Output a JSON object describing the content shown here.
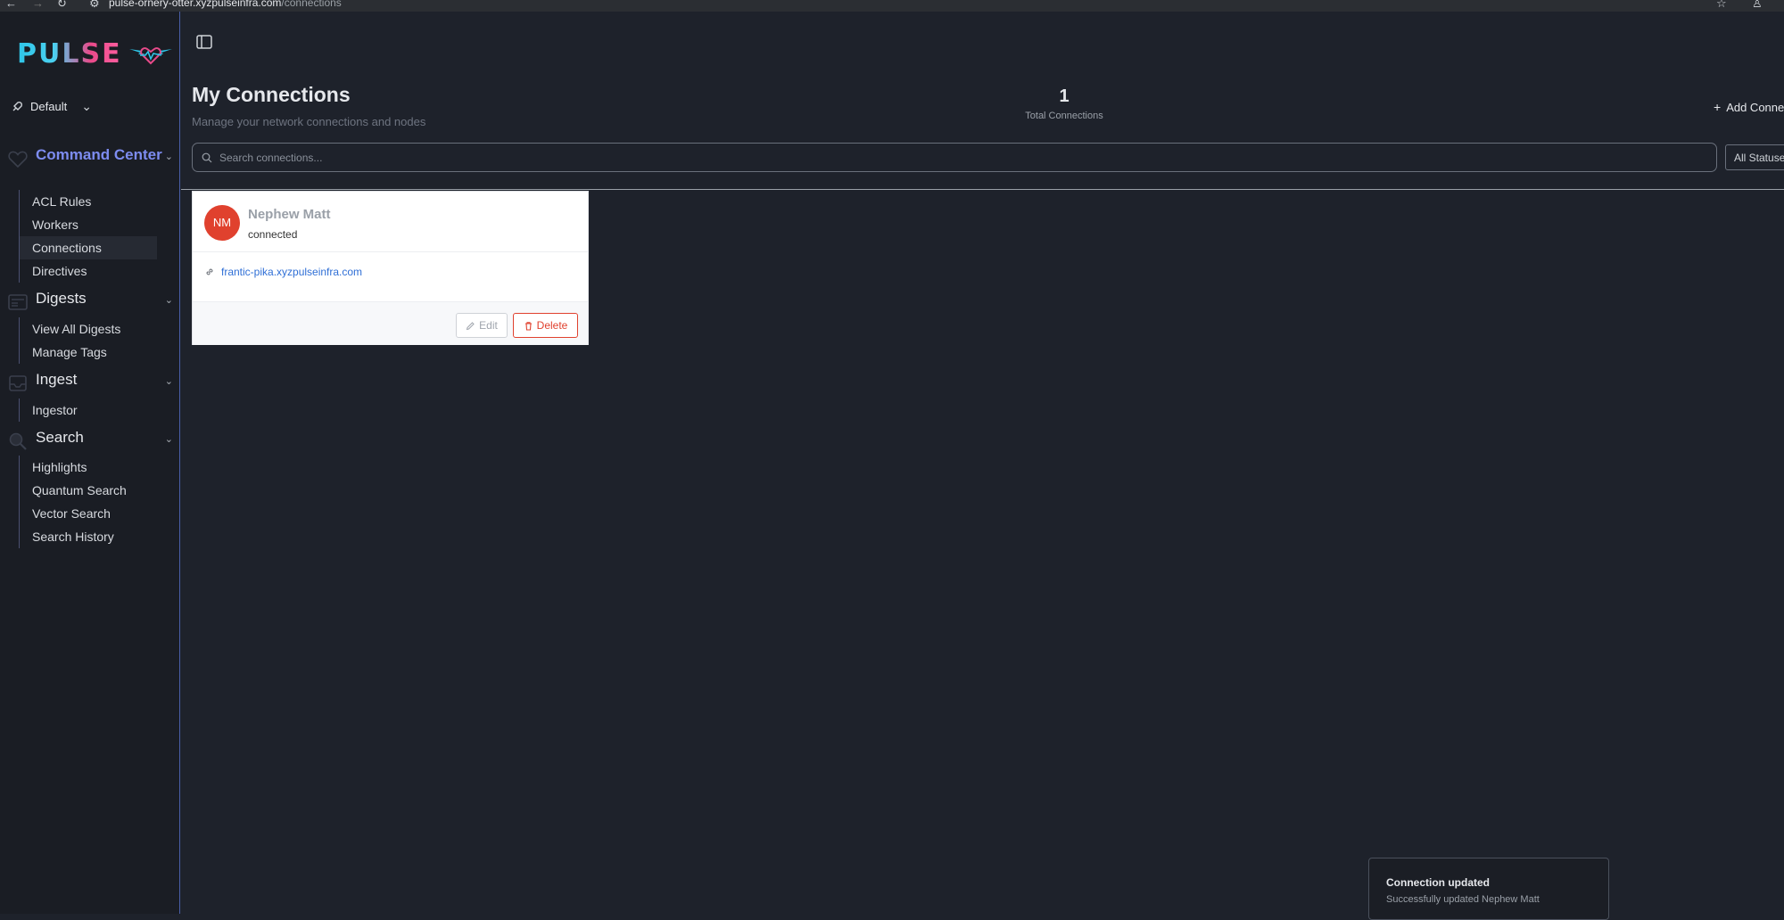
{
  "browser": {
    "url_host": "pulse-ornery-otter.xyzpulseinfra.com",
    "url_path": "/connections"
  },
  "sidebar": {
    "logo_text": "PULSE",
    "workspace": "Default",
    "sections": [
      {
        "label": "Command Center",
        "icon": "heart-outline-icon",
        "items": [
          "ACL Rules",
          "Workers",
          "Connections",
          "Directives"
        ]
      },
      {
        "label": "Digests",
        "icon": "newspaper-icon",
        "items": [
          "View All Digests",
          "Manage Tags"
        ]
      },
      {
        "label": "Ingest",
        "icon": "inbox-icon",
        "items": [
          "Ingestor"
        ]
      },
      {
        "label": "Search",
        "icon": "search-icon",
        "items": [
          "Highlights",
          "Quantum Search",
          "Vector Search",
          "Search History"
        ]
      }
    ],
    "active_item": "Connections"
  },
  "header": {
    "title": "My Connections",
    "subtitle": "Manage your network connections and nodes",
    "total_count": "1",
    "total_label": "Total Connections",
    "add_button": "Add Conne"
  },
  "search": {
    "placeholder": "Search connections...",
    "status_filter": "All Statuse"
  },
  "connections": [
    {
      "initials": "NM",
      "name": "Nephew Matt",
      "status": "connected",
      "host": "frantic-pika.xyzpulseinfra.com",
      "edit_label": "Edit",
      "delete_label": "Delete"
    }
  ],
  "toast": {
    "title": "Connection updated",
    "body": "Successfully updated Nephew Matt"
  },
  "colors": {
    "accent": "#7d8cf0",
    "danger": "#e0412e",
    "link": "#2f6fd6"
  }
}
